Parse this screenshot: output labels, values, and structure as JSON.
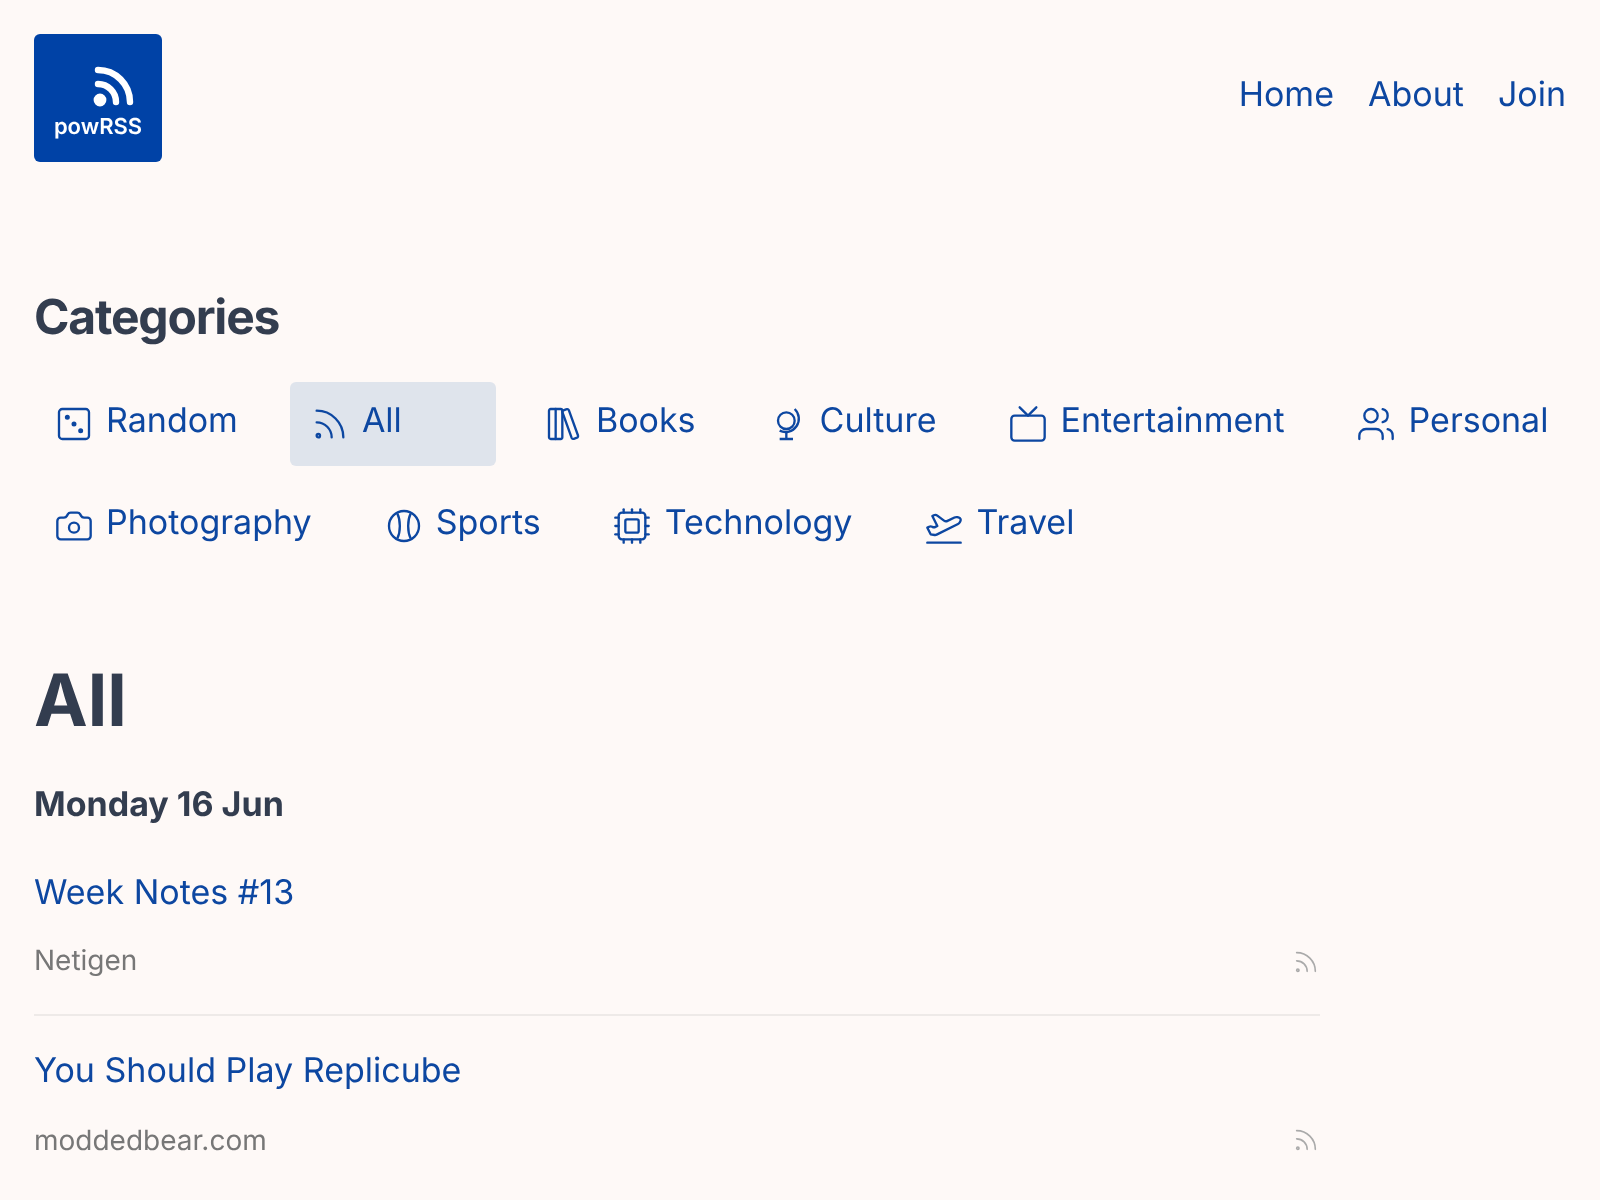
{
  "logo": {
    "text": "powRSS"
  },
  "nav": [
    "Home",
    "About",
    "Join"
  ],
  "categories_title": "Categories",
  "categories": [
    {
      "label": "Random",
      "selected": false
    },
    {
      "label": "All",
      "selected": true
    },
    {
      "label": "Books",
      "selected": false
    },
    {
      "label": "Culture",
      "selected": false
    },
    {
      "label": "Entertainment",
      "selected": false
    },
    {
      "label": "Personal",
      "selected": false
    },
    {
      "label": "Photography",
      "selected": false
    },
    {
      "label": "Sports",
      "selected": false
    },
    {
      "label": "Technology",
      "selected": false
    },
    {
      "label": "Travel",
      "selected": false
    }
  ],
  "page_title": "All",
  "date": "Monday 16 Jun",
  "posts": [
    {
      "title": "Week Notes #13",
      "source": "Netigen"
    },
    {
      "title": "You Should Play Replicube",
      "source": "moddedbear.com"
    }
  ]
}
